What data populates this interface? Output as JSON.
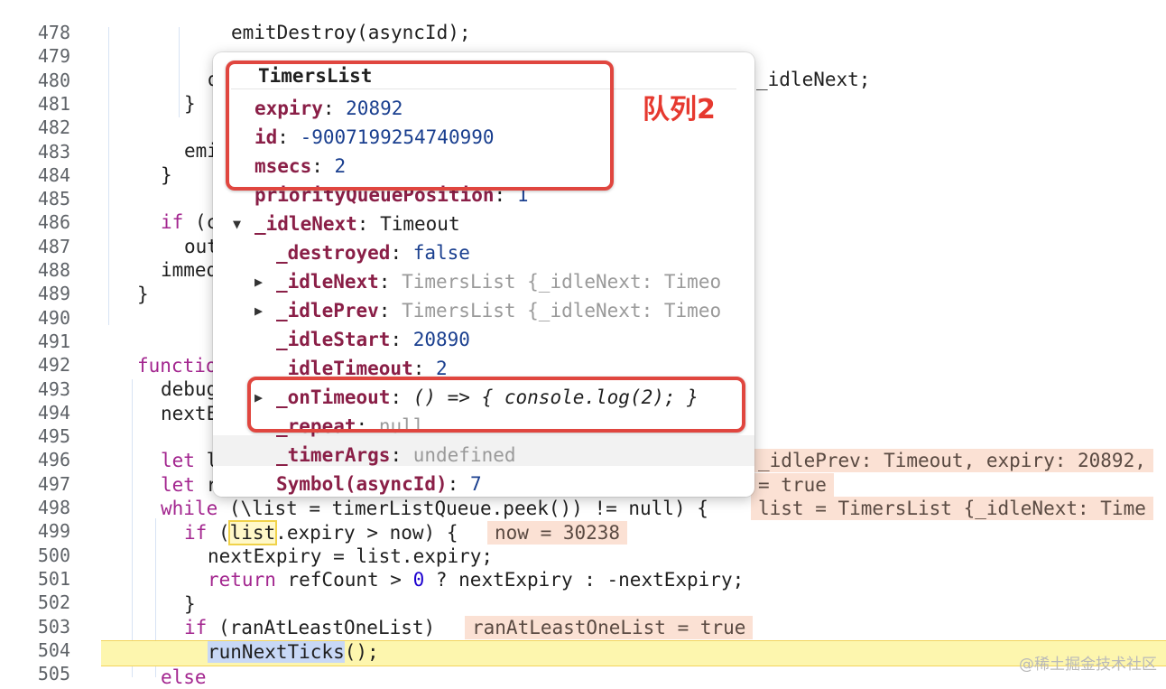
{
  "gutter": [
    "478",
    "479",
    "480",
    "481",
    "482",
    "483",
    "484",
    "485",
    "486",
    "487",
    "488",
    "489",
    "490",
    "491",
    "492",
    "493",
    "494",
    "495",
    "496",
    "497",
    "498",
    "499",
    "500",
    "501",
    "502",
    "503",
    "504",
    "505"
  ],
  "code": {
    "l478": "emitDestroy(asyncId);",
    "l480a": "d",
    "l480b": "_idleNext;",
    "l481": "}",
    "l483": "emi",
    "l484": "}",
    "l486a": "if",
    "l486b": " (c",
    "l487": "out",
    "l488": "immed",
    "l489": "}",
    "l492": "functio",
    "l493": "debug",
    "l494": "nextE",
    "l496a": "let",
    "l496b": " l",
    "l497a": "let",
    "l497b": " r",
    "l498a": "while",
    "l498b": " (\u0000",
    "l498c": "list = timerListQueue.peek()) != null) {",
    "l499a": "if",
    "l499b": " (",
    "l499c": "list",
    "l499d": ".expiry > now) {",
    "l500": "nextExpiry = list.expiry;",
    "l501a": "return",
    "l501b": " refCount > ",
    "l501c": "0",
    "l501d": " ? nextExpiry : -nextExpiry;",
    "l502": "}",
    "l503a": "if",
    "l503b": " (ranAtLeastOneList)",
    "l504a": "runNextTicks",
    "l504b": "();",
    "l505": "else"
  },
  "inline_values": {
    "v496": "_idlePrev: Timeout, expiry: 20892,",
    "v497": "= true",
    "v498": "list = TimersList {_idleNext: Time",
    "v499": "now = 30238",
    "v503": "ranAtLeastOneList = true"
  },
  "popover": {
    "title": "TimersList",
    "rows": {
      "expiry_key": "expiry",
      "expiry_val": "20892",
      "id_key": "id",
      "id_val": "-9007199254740990",
      "msecs_key": "msecs",
      "msecs_val": "2",
      "pqp_key": "priorityQueuePosition",
      "pqp_val": "1",
      "idleNext_key": "_idleNext",
      "idleNext_val": "Timeout",
      "destroyed_key": "_destroyed",
      "destroyed_val": "false",
      "inIdleNext_key": "_idleNext",
      "inIdleNext_val": "TimersList {_idleNext: Timeo",
      "idlePrev_key": "_idlePrev",
      "idlePrev_val": "TimersList {_idleNext: Timeo",
      "idleStart_key": "_idleStart",
      "idleStart_val": "20890",
      "idleTimeout_key": "_idleTimeout",
      "idleTimeout_val": "2",
      "onTimeout_key": "_onTimeout",
      "onTimeout_val": "() => { console.log(2); }",
      "repeat_key": "_repeat",
      "repeat_val": "null",
      "timerArgs_key": "_timerArgs",
      "timerArgs_val": "undefined",
      "symbol_key": "Symbol(asyncId)",
      "symbol_val": "7"
    }
  },
  "annotation": "队列2",
  "watermark": "@稀土掘金技术社区",
  "colors": {
    "annotation_red": "#e0463f",
    "current_line": "#fdf6ae",
    "inline_value_bg": "#fbe1d4",
    "property_key": "#8a1f47",
    "property_value": "#1a3f8f"
  }
}
